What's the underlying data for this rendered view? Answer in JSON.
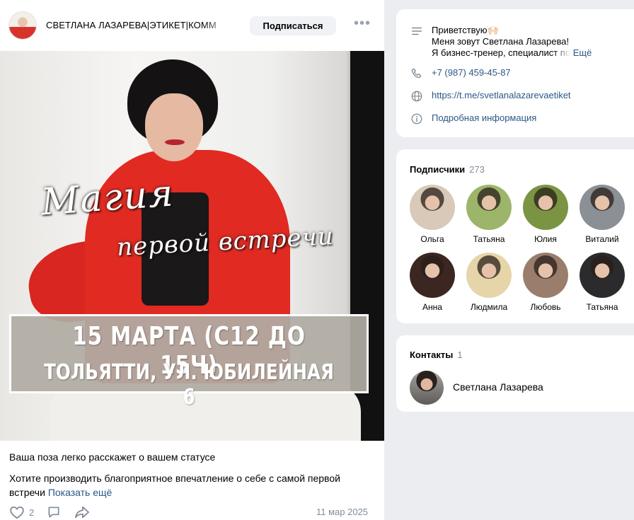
{
  "post": {
    "author": "СВЕТЛАНА ЛАЗАРЕВА|ЭТИКЕТ|КОММ",
    "subscribe_label": "Подписаться",
    "more_label": "•••",
    "image": {
      "script_line1": "Магия",
      "script_line2": "первой встречи",
      "banner_line1": "15 МАРТА (С12 ДО 15Ч)",
      "banner_line2": "ТОЛЬЯТТИ, УЛ. ЮБИЛЕЙНАЯ 6"
    },
    "text_line1": "Ваша поза легко расскажет о вашем статусе",
    "text_line2": "Хотите производить благоприятное впечатление о себе с самой первой встречи",
    "show_more": "Показать ещё",
    "likes": "2",
    "date": "11 мар 2025"
  },
  "info": {
    "greeting_line1": "Приветствую🙌🏻",
    "greeting_line2": "Меня зовут Светлана Лазарева!",
    "greeting_line3": "Я бизнес-тренер, специалист по",
    "more_link": "Ещё",
    "phone": "+7 (987) 459-45-87",
    "website": "https://t.me/svetlanalazarevaetiket",
    "details_link": "Подробная информация"
  },
  "subscribers": {
    "title": "Подписчики",
    "count": "273",
    "items": [
      {
        "name": "Ольга",
        "color": "#d9c9b8"
      },
      {
        "name": "Татьяна",
        "color": "#9db56a"
      },
      {
        "name": "Юлия",
        "color": "#7a9444"
      },
      {
        "name": "Виталий",
        "color": "#8b8f96"
      },
      {
        "name": "Анна",
        "color": "#3b2622"
      },
      {
        "name": "Людмила",
        "color": "#e6d5a9"
      },
      {
        "name": "Любовь",
        "color": "#9b7d6c"
      },
      {
        "name": "Татьяна",
        "color": "#2b2a2c"
      }
    ]
  },
  "contacts": {
    "title": "Контакты",
    "count": "1",
    "name": "Светлана Лазарева"
  },
  "colors": {
    "accent": "#2a5885",
    "muted": "#818c99",
    "jacket": "#e12a22"
  }
}
